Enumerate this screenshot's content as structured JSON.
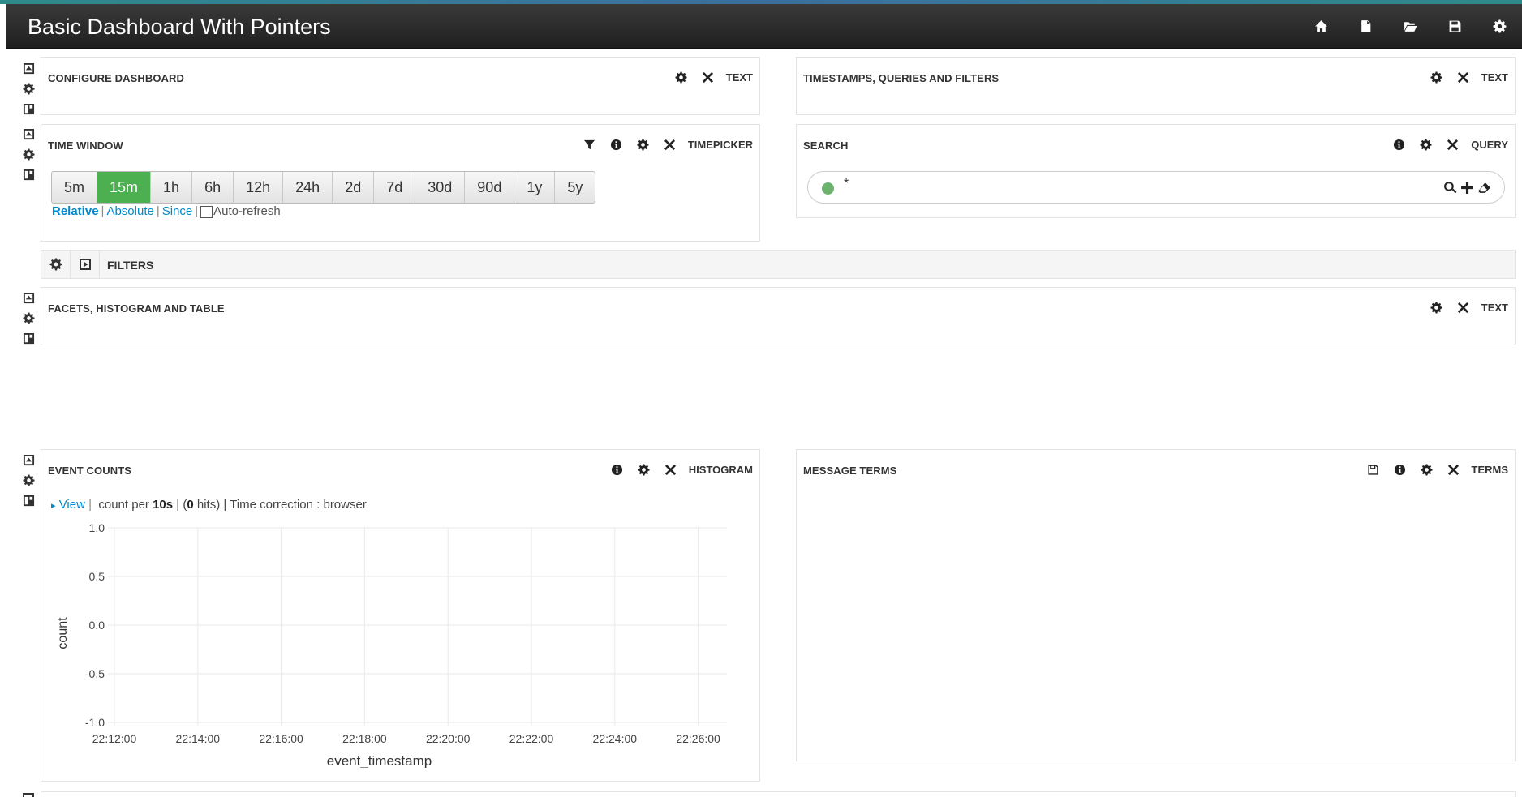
{
  "navbar": {
    "title": "Basic Dashboard With Pointers",
    "icons": [
      "home-icon",
      "new-file-icon",
      "open-folder-icon",
      "save-icon",
      "settings-icon"
    ]
  },
  "panels": {
    "configure": {
      "title": "CONFIGURE DASHBOARD",
      "type": "TEXT"
    },
    "timestamps": {
      "title": "TIMESTAMPS, QUERIES AND FILTERS",
      "type": "TEXT"
    },
    "timewindow": {
      "title": "TIME WINDOW",
      "type": "TIMEPICKER",
      "buttons": [
        "5m",
        "15m",
        "1h",
        "6h",
        "12h",
        "24h",
        "2d",
        "7d",
        "30d",
        "90d",
        "1y",
        "5y"
      ],
      "active": "15m",
      "modes": {
        "relative": "Relative",
        "absolute": "Absolute",
        "since": "Since",
        "autorefresh": "Auto-refresh"
      }
    },
    "search": {
      "title": "SEARCH",
      "type": "QUERY",
      "query": "*"
    },
    "filters": {
      "label": "FILTERS"
    },
    "facets": {
      "title": "FACETS, HISTOGRAM AND TABLE",
      "type": "TEXT"
    },
    "eventcounts": {
      "title": "EVENT COUNTS",
      "type": "HISTOGRAM",
      "view": "View",
      "info": {
        "prefix": "count per ",
        "interval": "10s",
        "hits_open": " | (",
        "hits": "0",
        "hits_close": " hits) | Time correction : browser"
      }
    },
    "messageterms": {
      "title": "MESSAGE TERMS",
      "type": "TERMS"
    }
  },
  "chart_data": {
    "type": "bar",
    "x": [
      "22:12:00",
      "22:14:00",
      "22:16:00",
      "22:18:00",
      "22:20:00",
      "22:22:00",
      "22:24:00",
      "22:26:00"
    ],
    "y_ticks": [
      "1.0",
      "0.5",
      "0.0",
      "-0.5",
      "-1.0"
    ],
    "ylim": [
      -1.0,
      1.0
    ],
    "xlabel": "event_timestamp",
    "ylabel": "count",
    "values": [],
    "grid": true
  }
}
